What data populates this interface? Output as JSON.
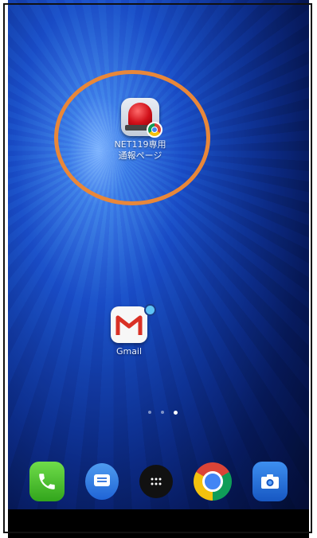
{
  "home_screen": {
    "apps": [
      {
        "label": "NET119専用\n通報ページ",
        "icon": "siren-icon"
      },
      {
        "label": "Gmail",
        "icon": "gmail-icon"
      }
    ],
    "page_indicator": {
      "count": 3,
      "current": 3
    }
  },
  "dock": {
    "items": [
      {
        "icon": "phone-icon"
      },
      {
        "icon": "messages-icon"
      },
      {
        "icon": "app-drawer-icon"
      },
      {
        "icon": "chrome-icon"
      },
      {
        "icon": "camera-icon"
      }
    ]
  },
  "annotation": {
    "color": "#e8873a"
  }
}
